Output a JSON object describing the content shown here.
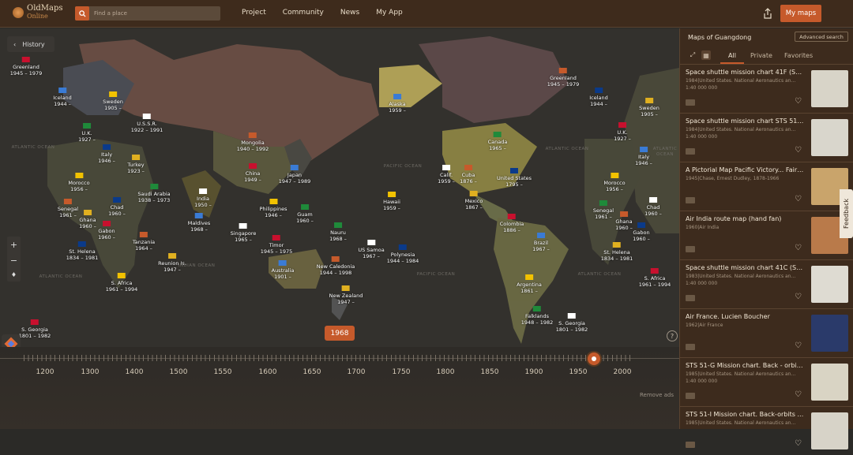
{
  "app": {
    "logo_line1": "OldMaps",
    "logo_line2": "Online",
    "search_placeholder": "Find a place",
    "nav": [
      "Project",
      "Community",
      "News",
      "My App"
    ],
    "my_maps": "My maps"
  },
  "map": {
    "history": "History",
    "year": "1968",
    "labels": [
      [
        "Greenland",
        "1945 – 1979"
      ],
      [
        "Iceland",
        "1944 –"
      ],
      [
        "Sweden",
        "1905 –"
      ],
      [
        "U.K.",
        "1927 –"
      ],
      [
        "U.S.S.R.",
        "1922 – 1991"
      ],
      [
        "Mongolia",
        "1940 – 1992"
      ],
      [
        "Italy",
        "1946 –"
      ],
      [
        "Turkey",
        "1923 –"
      ],
      [
        "China",
        "1949 –"
      ],
      [
        "Japan",
        "1947 – 1989"
      ],
      [
        "Morocco",
        "1956 –"
      ],
      [
        "Saudi Arabia",
        "1938 – 1973"
      ],
      [
        "India",
        "1950 –"
      ],
      [
        "Senegal",
        "1961 –"
      ],
      [
        "Chad",
        "1960 –"
      ],
      [
        "Ghana",
        "1960 –"
      ],
      [
        "Gabon",
        "1960 –"
      ],
      [
        "Maldives",
        "1968 –"
      ],
      [
        "Philippines",
        "1946 –"
      ],
      [
        "Guam",
        "1960 –"
      ],
      [
        "Singapore",
        "1965 –"
      ],
      [
        "Tanzania",
        "1964 –"
      ],
      [
        "St. Helena",
        "1834 – 1981"
      ],
      [
        "Reunion Is.",
        "1947 –"
      ],
      [
        "Timor",
        "1945 – 1975"
      ],
      [
        "Australia",
        "1901 –"
      ],
      [
        "S. Africa",
        "1961 – 1994"
      ],
      [
        "Nauru",
        "1968 –"
      ],
      [
        "US Samoa",
        "1967 –"
      ],
      [
        "New Caledonia",
        "1944 – 1998"
      ],
      [
        "Polynesia",
        "1944 – 1984"
      ],
      [
        "New Zealand",
        "1947 –"
      ],
      [
        "S. Georgia",
        "1801 – 1982"
      ],
      [
        "Alaska",
        "1959 –"
      ],
      [
        "Hawaii",
        "1959 –"
      ],
      [
        "Canada",
        "1965 –"
      ],
      [
        "Calif.",
        "1959 –"
      ],
      [
        "Cuba",
        "1876 –"
      ],
      [
        "United States",
        "1795 –"
      ],
      [
        "Mexico",
        "1867 –"
      ],
      [
        "Colombia",
        "1886 –"
      ],
      [
        "Brazil",
        "1967 –"
      ],
      [
        "Argentina",
        "1861 –"
      ],
      [
        "Falklands",
        "1948 – 1982"
      ],
      [
        "S. Georgia",
        "1801 – 1982"
      ],
      [
        "Greenland",
        "1945 – 1979"
      ],
      [
        "Iceland",
        "1944 –"
      ],
      [
        "Sweden",
        "1905 –"
      ],
      [
        "U.K.",
        "1927 –"
      ],
      [
        "Italy",
        "1946 –"
      ],
      [
        "Morocco",
        "1956 –"
      ],
      [
        "Senegal",
        "1961 –"
      ],
      [
        "Chad",
        "1960 –"
      ],
      [
        "Ghana",
        "1960 –"
      ],
      [
        "Gabon",
        "1960 –"
      ],
      [
        "St. Helena",
        "1834 – 1981"
      ],
      [
        "S. Africa",
        "1961 – 1994"
      ]
    ],
    "oceans": [
      "ATLANTIC OCEAN",
      "INDIAN OCEAN",
      "ATLANTIC OCEAN",
      "PACIFIC OCEAN",
      "PACIFIC OCEAN",
      "ATLANTIC OCEAN",
      "ATLANTIC OCEAN",
      "ATLANTIC OCEAN"
    ],
    "years": [
      "1200",
      "1300",
      "1400",
      "1500",
      "1550",
      "1600",
      "1650",
      "1700",
      "1750",
      "1800",
      "1850",
      "1900",
      "1950",
      "2000"
    ],
    "remove_ads": "Remove ads"
  },
  "panel": {
    "title": "Maps of Guangdong",
    "advanced": "Advanced search",
    "tabs": [
      "All",
      "Private",
      "Favorites"
    ],
    "items": [
      {
        "title": "Space shuttle mission chart 41F (STS…",
        "meta": "1984|United States. National Aeronautics an…",
        "scale": "1:40 000 000"
      },
      {
        "title": "Space shuttle mission chart STS 51-…",
        "meta": "1984|United States. National Aeronautics an…",
        "scale": "1:40 000 000"
      },
      {
        "title": "A Pictorial Map Pacific Victory... Fairfi…",
        "meta": "1945|Chase, Ernest Dudley, 1878-1966",
        "scale": ""
      },
      {
        "title": "Air India route map (hand fan)",
        "meta": "1960|Air India",
        "scale": ""
      },
      {
        "title": "Space shuttle mission chart 41C (ST…",
        "meta": "1983|United States. National Aeronautics an…",
        "scale": "1:40 000 000"
      },
      {
        "title": "Air France. Lucien Boucher",
        "meta": "1962|Air France",
        "scale": ""
      },
      {
        "title": "STS 51-G Mission chart. Back - orbits…",
        "meta": "1985|United States. National Aeronautics an…",
        "scale": "1:40 000 000"
      },
      {
        "title": "STS 51-I Mission chart. Back-orbits 8…",
        "meta": "1985|United States. National Aeronautics an…",
        "scale": ""
      }
    ],
    "feedback": "Feedback"
  }
}
